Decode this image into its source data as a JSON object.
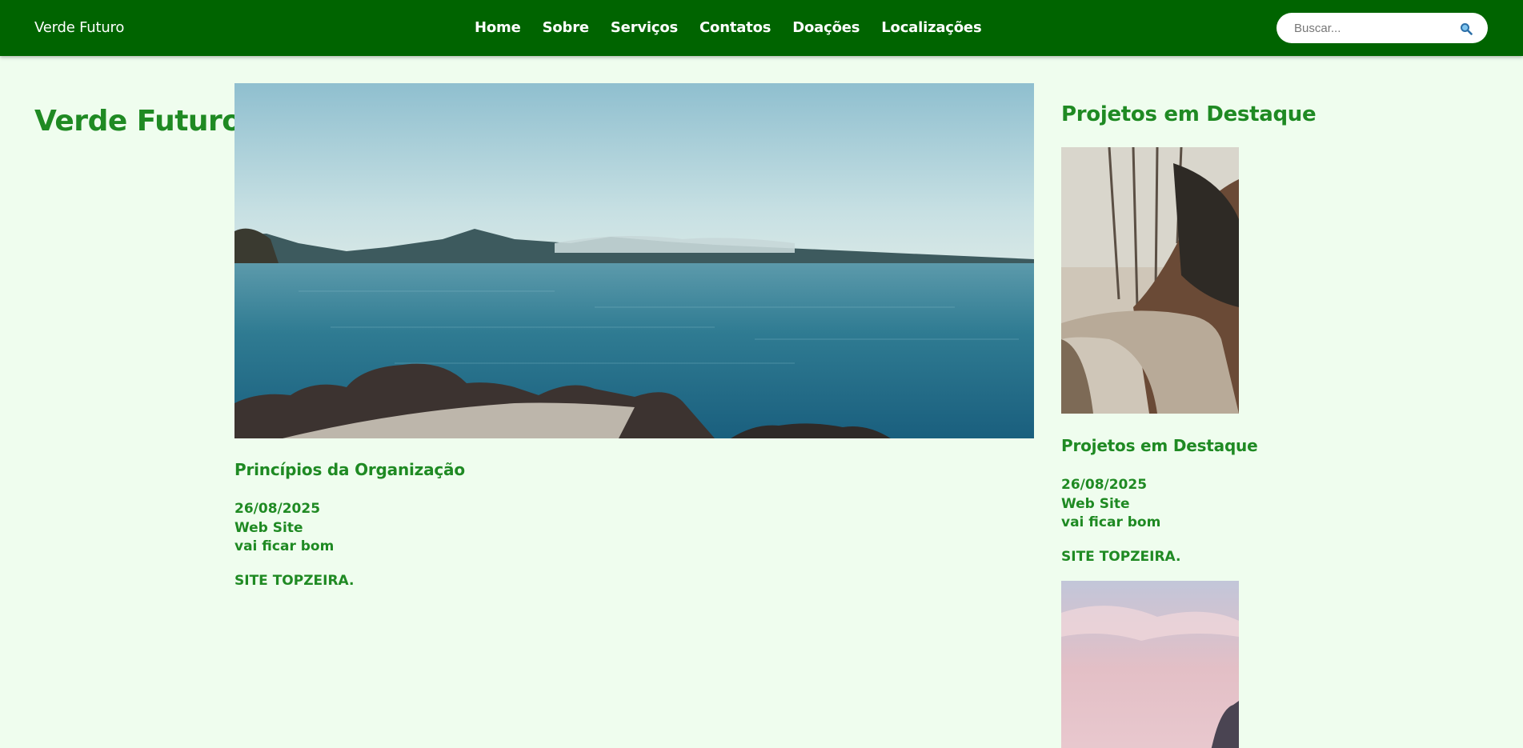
{
  "header": {
    "brand": "Verde Futuro",
    "nav": [
      "Home",
      "Sobre",
      "Serviços",
      "Contatos",
      "Doações",
      "Localizações"
    ],
    "search": {
      "placeholder": "Buscar...",
      "button_icon": "search-icon"
    }
  },
  "main": {
    "site_title": "Verde Futuro",
    "article": {
      "title": "Princípios da Organização",
      "date": "26/08/2025",
      "category": "Web Site",
      "subtitle": "vai ficar bom",
      "body": "SITE TOPZEIRA."
    }
  },
  "sidebar": {
    "heading": "Projetos em Destaque",
    "project": {
      "title": "Projetos em Destaque",
      "date": "26/08/2025",
      "category": "Web Site",
      "subtitle": "vai ficar bom",
      "body": "SITE TOPZEIRA."
    }
  },
  "colors": {
    "header_bg": "#006400",
    "page_bg": "#effdee",
    "accent_text": "#1f8a23"
  }
}
